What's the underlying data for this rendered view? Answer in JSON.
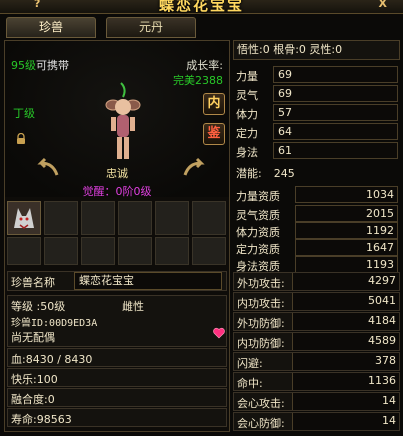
{
  "window": {
    "title": "蝶恋花宝宝",
    "help": "?",
    "close": "X"
  },
  "tabs": [
    {
      "label": "珍兽"
    },
    {
      "label": "元丹"
    }
  ],
  "pet": {
    "carry_level": "95级",
    "carry_text": "可携带",
    "growth_label": "成长率:",
    "growth_value": "完美2388",
    "grade": "丁级",
    "temper": "忠诚",
    "awaken": "觉醒：0阶0级",
    "btn_inner": "内",
    "btn_appraise": "鉴"
  },
  "info": {
    "name_label": "珍兽名称",
    "name_value": "蝶恋花宝宝",
    "level": "等级 :50级",
    "gender": "雌性",
    "pet_id": "珍兽ID:00D9ED3A",
    "mate": "尚无配偶",
    "hp": "血:8430 / 8430",
    "happiness": "快乐:100",
    "fusion": "融合度:0",
    "lifespan": "寿命:98563"
  },
  "top_stats": "悟性:0  根骨:0  灵性:0",
  "attributes": [
    {
      "label": "力量",
      "value": "69"
    },
    {
      "label": "灵气",
      "value": "69"
    },
    {
      "label": "体力",
      "value": "57"
    },
    {
      "label": "定力",
      "value": "64"
    },
    {
      "label": "身法",
      "value": "61"
    }
  ],
  "potential": {
    "label": "潜能:",
    "value": "245"
  },
  "aptitudes": [
    {
      "label": "力量资质",
      "value": "1034"
    },
    {
      "label": "灵气资质",
      "value": "2015"
    },
    {
      "label": "体力资质",
      "value": "1192"
    },
    {
      "label": "定力资质",
      "value": "1647"
    },
    {
      "label": "身法资质",
      "value": "1193"
    }
  ],
  "combat": [
    {
      "label": "外功攻击:",
      "value": "4297"
    },
    {
      "label": "内功攻击:",
      "value": "5041"
    },
    {
      "label": "外功防御:",
      "value": "4184"
    },
    {
      "label": "内功防御:",
      "value": "4589"
    },
    {
      "label": "闪避:",
      "value": "378"
    },
    {
      "label": "命中:",
      "value": "1136"
    },
    {
      "label": "会心攻击:",
      "value": "14"
    },
    {
      "label": "会心防御:",
      "value": "14"
    }
  ]
}
